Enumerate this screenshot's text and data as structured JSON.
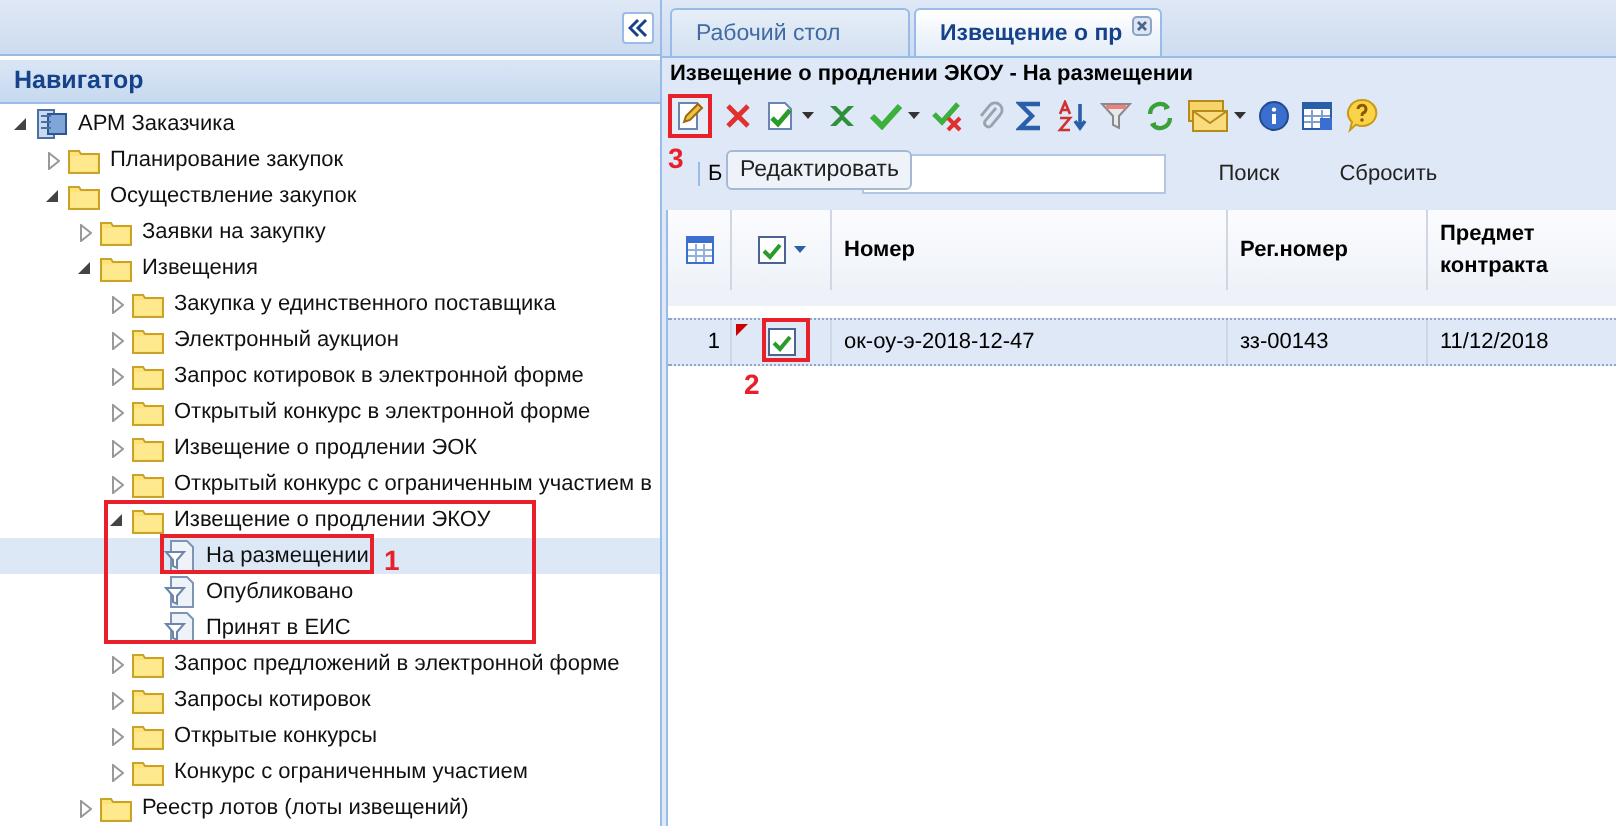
{
  "navigator": {
    "title": "Навигатор",
    "tree": [
      {
        "label": "АРМ Заказчика",
        "kind": "root",
        "expanded": true,
        "selected": false,
        "children": [
          {
            "label": "Планирование закупок",
            "kind": "folder",
            "expanded": false,
            "selected": false
          },
          {
            "label": "Осуществление закупок",
            "kind": "folder",
            "expanded": true,
            "selected": false,
            "children": [
              {
                "label": "Заявки на закупку",
                "kind": "folder",
                "expanded": false,
                "selected": false
              },
              {
                "label": "Извещения",
                "kind": "folder",
                "expanded": true,
                "selected": false,
                "children": [
                  {
                    "label": "Закупка у единственного поставщика",
                    "kind": "folder",
                    "expanded": false,
                    "selected": false
                  },
                  {
                    "label": "Электронный аукцион",
                    "kind": "folder",
                    "expanded": false,
                    "selected": false
                  },
                  {
                    "label": "Запрос котировок в электронной форме",
                    "kind": "folder",
                    "expanded": false,
                    "selected": false
                  },
                  {
                    "label": "Открытый конкурс в электронной форме",
                    "kind": "folder",
                    "expanded": false,
                    "selected": false
                  },
                  {
                    "label": "Извещение о продлении ЭОК",
                    "kind": "folder",
                    "expanded": false,
                    "selected": false
                  },
                  {
                    "label": "Открытый конкурс с ограниченным участием в",
                    "kind": "folder",
                    "expanded": false,
                    "selected": false
                  },
                  {
                    "label": "Извещение о продлении ЭКОУ",
                    "kind": "folder",
                    "expanded": true,
                    "selected": false,
                    "children": [
                      {
                        "label": "На размещении",
                        "kind": "filter",
                        "selected": true
                      },
                      {
                        "label": "Опубликовано",
                        "kind": "filter",
                        "selected": false
                      },
                      {
                        "label": "Принят в ЕИС",
                        "kind": "filter",
                        "selected": false
                      }
                    ]
                  },
                  {
                    "label": "Запрос предложений в электронной форме",
                    "kind": "folder",
                    "expanded": false,
                    "selected": false
                  },
                  {
                    "label": "Запросы котировок",
                    "kind": "folder",
                    "expanded": false,
                    "selected": false
                  },
                  {
                    "label": "Открытые конкурсы",
                    "kind": "folder",
                    "expanded": false,
                    "selected": false
                  },
                  {
                    "label": "Конкурс с ограниченным участием",
                    "kind": "folder",
                    "expanded": false,
                    "selected": false
                  }
                ]
              },
              {
                "label": "Реестр лотов (лоты извещений)",
                "kind": "folder",
                "expanded": false,
                "selected": false
              }
            ]
          }
        ]
      }
    ]
  },
  "tabs": [
    {
      "label": "Рабочий стол",
      "selected": false,
      "closable": false
    },
    {
      "label": "Извещение о пр",
      "selected": true,
      "closable": true
    }
  ],
  "panel": {
    "title": "Извещение о продлении ЭКОУ - На размещении"
  },
  "tooltip": "Редактировать",
  "search": {
    "label": "Б",
    "buttons": [
      "Поиск",
      "Сбросить"
    ]
  },
  "grid": {
    "header_checked": true,
    "columns": [
      "Номер",
      "Рег.номер",
      "Предмет контракта"
    ],
    "rows": [
      {
        "number": "1",
        "selected": true,
        "checked": true,
        "modified": true,
        "cells": [
          "ок-оу-э-2018-12-47",
          "зз-00143",
          "11/12/2018"
        ]
      }
    ]
  },
  "callouts": [
    "1",
    "2",
    "3"
  ]
}
